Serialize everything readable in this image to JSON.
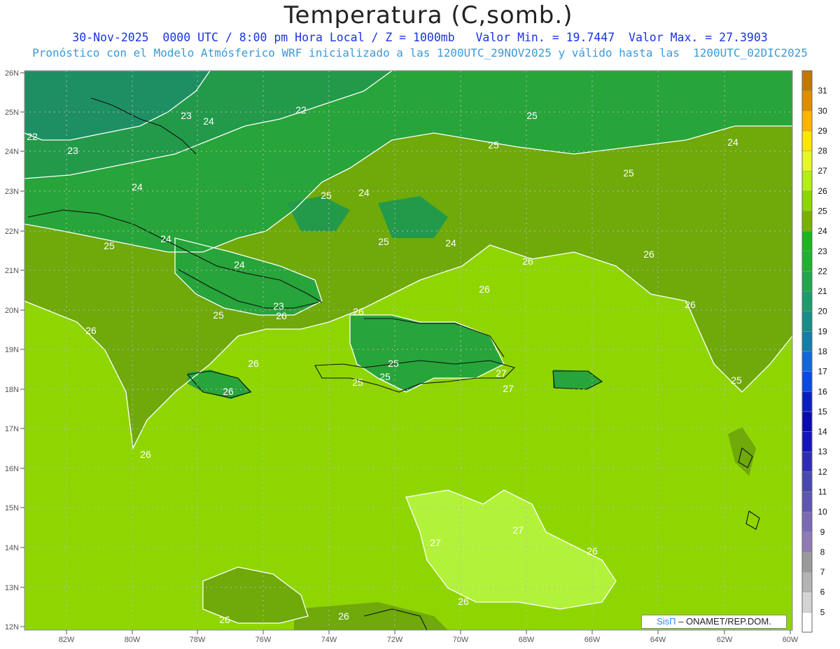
{
  "header": {
    "title": "Temperatura (C,somb.)",
    "subtitle_1": "30-Nov-2025  0000 UTC / 8:00 pm Hora Local / Z = 1000mb   Valor Min. = 19.7447  Valor Max. = 27.3903",
    "subtitle_2": "Pronóstico con el Modelo Atmósferico WRF inicializado a las 1200UTC_29NOV2025 y válido hasta las  1200UTC_02DIC2025"
  },
  "credit": {
    "brand": "SisΠ",
    "text": "– ONAMET/REP.DOM."
  },
  "map": {
    "lat_ticks": [
      "26N",
      "25N",
      "24N",
      "23N",
      "22N",
      "21N",
      "20N",
      "19N",
      "18N",
      "17N",
      "16N",
      "15N",
      "14N",
      "13N",
      "12N"
    ],
    "lon_ticks": [
      "82W",
      "80W",
      "78W",
      "76W",
      "74W",
      "72W",
      "70W",
      "68W",
      "66W",
      "64W",
      "62W",
      "60W"
    ],
    "contour_labels": [
      "22",
      "23",
      "24",
      "22",
      "23",
      "24",
      "25",
      "25",
      "25",
      "24",
      "24",
      "25",
      "24",
      "24",
      "24",
      "23",
      "25",
      "25",
      "25",
      "26",
      "26",
      "26",
      "26",
      "26",
      "26",
      "26",
      "26",
      "26",
      "25",
      "25",
      "25",
      "26",
      "27",
      "27",
      "27",
      "27",
      "26",
      "26",
      "25"
    ]
  },
  "colorbar": {
    "levels": [
      "5",
      "6",
      "7",
      "8",
      "9",
      "10",
      "11",
      "12",
      "13",
      "14",
      "15",
      "16",
      "17",
      "18",
      "19",
      "20",
      "21",
      "22",
      "23",
      "24",
      "25",
      "26",
      "27",
      "28",
      "29",
      "30",
      "31"
    ],
    "colors": [
      "#ffffff",
      "#d4d4d4",
      "#b4b4b4",
      "#9a9a9a",
      "#8e7ab4",
      "#7a6ab4",
      "#5d56b0",
      "#4848b0",
      "#2c2cb4",
      "#1414b8",
      "#0a0ab0",
      "#0a1ec0",
      "#0a4ae0",
      "#1068d8",
      "#137ea8",
      "#1a8c88",
      "#1d9a6c",
      "#20a64c",
      "#20b030",
      "#1eb41e",
      "#7ab000",
      "#8cd600",
      "#b4ee14",
      "#e6f826",
      "#ffe600",
      "#ffb400",
      "#e08c00",
      "#c07800"
    ]
  },
  "colors": {
    "t23": "#229a4a",
    "t24": "#27a43a",
    "t25": "#6fa90a",
    "t26": "#8fd600",
    "t27": "#b3f23a",
    "t22": "#1d8f63"
  }
}
